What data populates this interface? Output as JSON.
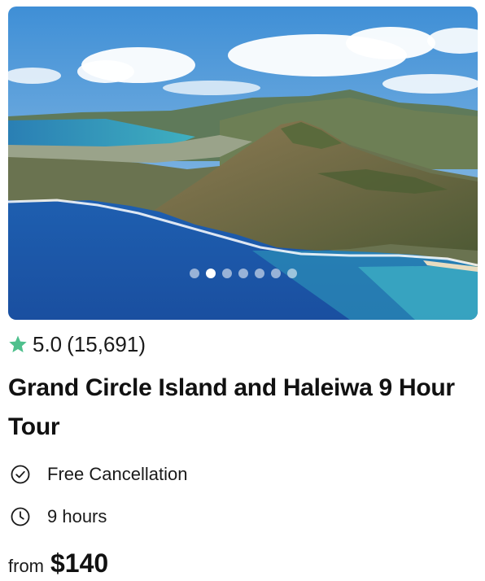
{
  "card": {
    "image": {
      "alt_icon": "photo",
      "slides_total": 7,
      "active_slide": 2
    },
    "rating": {
      "score": "5.0",
      "count": "(15,691)",
      "star_color": "#4fc08d"
    },
    "title": "Grand Circle Island and Haleiwa 9 Hour Tour",
    "features": [
      {
        "icon": "check-circle-icon",
        "label": "Free Cancellation"
      },
      {
        "icon": "clock-icon",
        "label": "9 hours"
      }
    ],
    "price": {
      "prefix": "from",
      "amount": "$140"
    }
  }
}
